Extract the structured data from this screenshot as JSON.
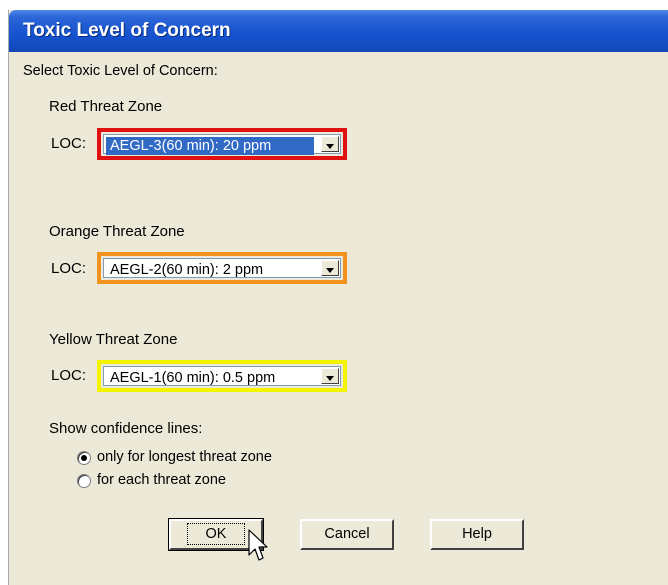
{
  "window": {
    "title": "Toxic Level of Concern"
  },
  "instruction": "Select Toxic Level of Concern:",
  "zones": [
    {
      "name": "Red Threat Zone",
      "loc_label": "LOC:",
      "value": "AEGL-3(60 min): 20 ppm",
      "highlight_color": "#e01010",
      "selected": true
    },
    {
      "name": "Orange Threat Zone",
      "loc_label": "LOC:",
      "value": "AEGL-2(60 min): 2 ppm",
      "highlight_color": "#f2931f",
      "selected": false
    },
    {
      "name": "Yellow Threat Zone",
      "loc_label": "LOC:",
      "value": "AEGL-1(60 min): 0.5 ppm",
      "highlight_color": "#f4f400",
      "selected": false
    }
  ],
  "confidence": {
    "label": "Show confidence lines:",
    "options": [
      {
        "label": "only for longest threat zone",
        "checked": true
      },
      {
        "label": "for each threat zone",
        "checked": false
      }
    ]
  },
  "buttons": {
    "ok": "OK",
    "cancel": "Cancel",
    "help": "Help"
  },
  "colors": {
    "titlebar": "#1553cf",
    "dialog_bg": "#ece9d8",
    "selection": "#316ac5"
  }
}
